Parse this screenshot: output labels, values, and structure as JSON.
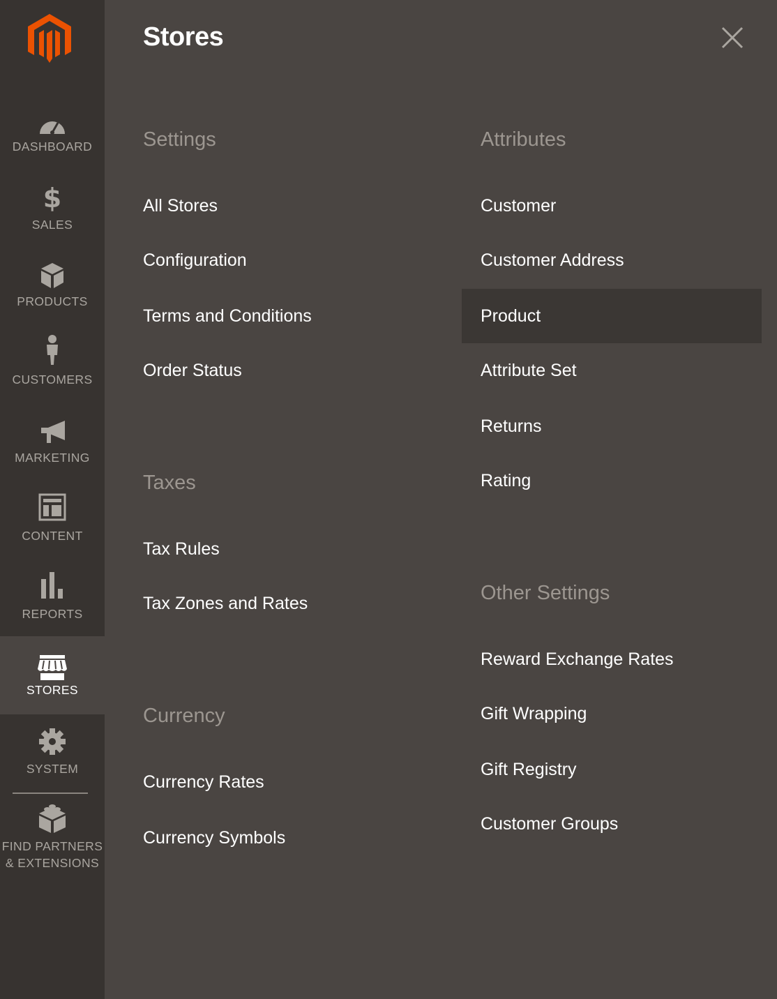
{
  "sidebar": {
    "logo": "magento-logo",
    "items": [
      {
        "label": "DASHBOARD",
        "icon": "speedometer-icon",
        "active": false
      },
      {
        "label": "SALES",
        "icon": "dollar-icon",
        "active": false
      },
      {
        "label": "PRODUCTS",
        "icon": "box-icon",
        "active": false
      },
      {
        "label": "CUSTOMERS",
        "icon": "person-icon",
        "active": false
      },
      {
        "label": "MARKETING",
        "icon": "megaphone-icon",
        "active": false
      },
      {
        "label": "CONTENT",
        "icon": "layout-icon",
        "active": false
      },
      {
        "label": "REPORTS",
        "icon": "bar-chart-icon",
        "active": false
      },
      {
        "label": "STORES",
        "icon": "storefront-icon",
        "active": true
      },
      {
        "label": "SYSTEM",
        "icon": "gear-icon",
        "active": false
      },
      {
        "label": "FIND PARTNERS",
        "label2": "& EXTENSIONS",
        "icon": "blocks-icon",
        "active": false
      }
    ]
  },
  "panel": {
    "title": "Stores",
    "groups": [
      {
        "title": "Settings",
        "items": [
          "All Stores",
          "Configuration",
          "Terms and Conditions",
          "Order Status"
        ]
      },
      {
        "title": "Taxes",
        "items": [
          "Tax Rules",
          "Tax Zones and Rates"
        ]
      },
      {
        "title": "Currency",
        "items": [
          "Currency Rates",
          "Currency Symbols"
        ]
      },
      {
        "title": "Attributes",
        "items": [
          "Customer",
          "Customer Address",
          "Product",
          "Attribute Set",
          "Returns",
          "Rating"
        ]
      },
      {
        "title": "Other Settings",
        "items": [
          "Reward Exchange Rates",
          "Gift Wrapping",
          "Gift Registry",
          "Customer Groups"
        ]
      }
    ],
    "highlighted_item": "Product"
  },
  "colors": {
    "sidebar_bg": "#373330",
    "panel_bg": "#4a4542",
    "highlight_bg": "#3b3734",
    "accent_orange": "#eb5202",
    "group_title": "#9c9690",
    "link": "#ffffff"
  }
}
